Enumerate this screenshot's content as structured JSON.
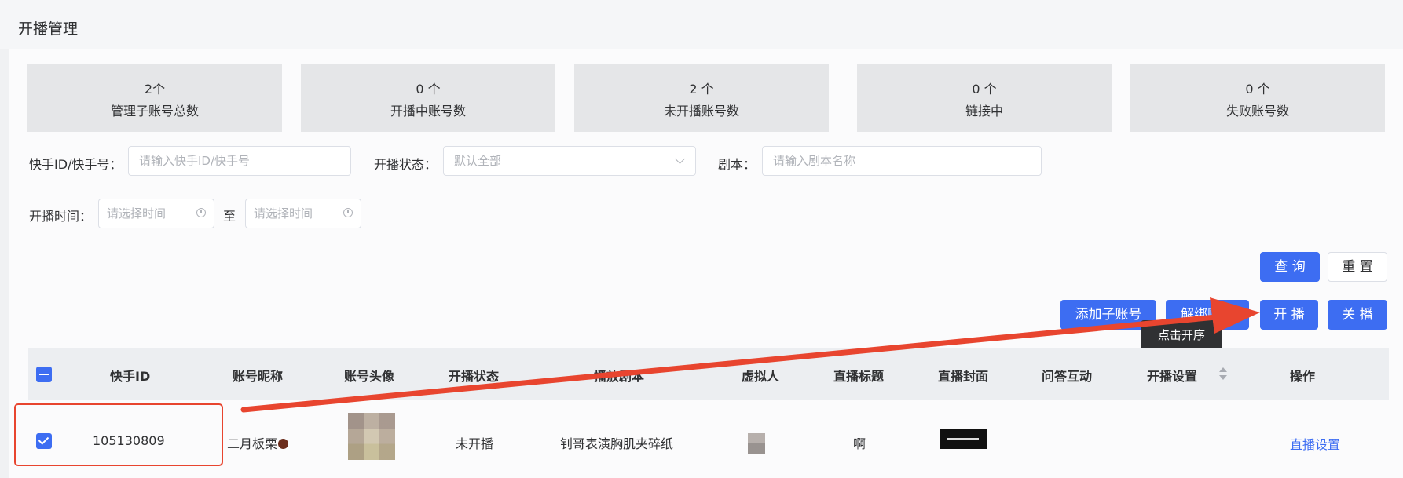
{
  "page": {
    "title": "开播管理"
  },
  "stats": [
    {
      "value": "2个",
      "label": "管理子账号总数"
    },
    {
      "value": "0 个",
      "label": "开播中账号数"
    },
    {
      "value": "2 个",
      "label": "未开播账号数"
    },
    {
      "value": "0 个",
      "label": "链接中"
    },
    {
      "value": "0 个",
      "label": "失败账号数"
    }
  ],
  "filters": {
    "account_label": "快手ID/快手号：",
    "account_placeholder": "请输入快手ID/快手号",
    "status_label": "开播状态：",
    "status_value": "默认全部",
    "script_label": "剧本：",
    "script_placeholder": "请输入剧本名称",
    "time_label": "开播时间：",
    "time_start_placeholder": "请选择时间",
    "time_sep": "至",
    "time_end_placeholder": "请选择时间"
  },
  "actions": {
    "query": "查 询",
    "reset": "重 置",
    "add_sub": "添加子账号",
    "unbind": "解绑账号",
    "start": "开 播",
    "stop": "关 播",
    "tooltip": "点击开序"
  },
  "table": {
    "columns": [
      "快手ID",
      "账号昵称",
      "账号头像",
      "开播状态",
      "播放剧本",
      "虚拟人",
      "直播标题",
      "直播封面",
      "问答互动",
      "开播设置",
      "操作"
    ],
    "rows": [
      {
        "kuaishou_id": "105130809",
        "nickname": "二月板栗",
        "status": "未开播",
        "script": "钊哥表演胸肌夹碎纸",
        "title": "啊",
        "op_link": "直播设置"
      }
    ]
  },
  "colors": {
    "primary": "#3d6df2",
    "annotation": "#e8452f"
  }
}
